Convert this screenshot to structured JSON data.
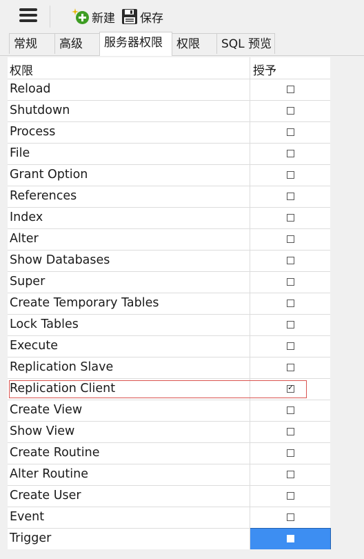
{
  "toolbar": {
    "menu_icon": "hamburger-menu-icon",
    "new_label": "新建",
    "new_icon": "add-new-icon",
    "save_label": "保存",
    "save_icon": "floppy-disk-icon"
  },
  "tabs": [
    {
      "label": "常规",
      "active": false
    },
    {
      "label": "高级",
      "active": false
    },
    {
      "label": "服务器权限",
      "active": true
    },
    {
      "label": "权限",
      "active": false
    },
    {
      "label": "SQL 预览",
      "active": false
    }
  ],
  "grid": {
    "col_privilege": "权限",
    "col_grant": "授予",
    "rows": [
      {
        "name": "Reload",
        "granted": false
      },
      {
        "name": "Shutdown",
        "granted": false
      },
      {
        "name": "Process",
        "granted": false
      },
      {
        "name": "File",
        "granted": false
      },
      {
        "name": "Grant Option",
        "granted": false
      },
      {
        "name": "References",
        "granted": false
      },
      {
        "name": "Index",
        "granted": false
      },
      {
        "name": "Alter",
        "granted": false
      },
      {
        "name": "Show Databases",
        "granted": false
      },
      {
        "name": "Super",
        "granted": false
      },
      {
        "name": "Create Temporary Tables",
        "granted": false
      },
      {
        "name": "Lock Tables",
        "granted": false
      },
      {
        "name": "Execute",
        "granted": false
      },
      {
        "name": "Replication Slave",
        "granted": false
      },
      {
        "name": "Replication Client",
        "granted": true,
        "highlighted": true
      },
      {
        "name": "Create View",
        "granted": false
      },
      {
        "name": "Show View",
        "granted": false
      },
      {
        "name": "Create Routine",
        "granted": false
      },
      {
        "name": "Alter Routine",
        "granted": false
      },
      {
        "name": "Create User",
        "granted": false
      },
      {
        "name": "Event",
        "granted": false
      },
      {
        "name": "Trigger",
        "granted": false,
        "selected": true
      }
    ]
  },
  "colors": {
    "selection": "#3d8ef2",
    "highlight_border": "#d9534f",
    "new_icon_green": "#3e9d24"
  }
}
